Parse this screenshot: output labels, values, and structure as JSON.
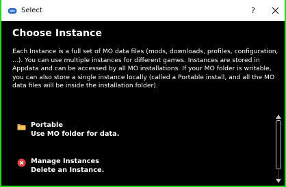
{
  "window": {
    "title": "Select",
    "help_label": "?",
    "app_icon": "controller-icon",
    "close_icon": "close-icon",
    "accent_color": "#19e019"
  },
  "page": {
    "heading": "Choose Instance",
    "description": "Each Instance is a full set of MO data files (mods, downloads, profiles, configuration, ...). You can use multiple instances for different games. Instances are stored in Appdata and can be accessed by all MO installations. If your MO folder is writable, you can also store a single instance locally (called a Portable install, and all the MO data files will be inside the installation folder)."
  },
  "options": [
    {
      "title": "Portable",
      "subtitle": "Use MO folder for data.",
      "icon": "folder-icon"
    },
    {
      "title": "Manage Instances",
      "subtitle": "Delete an Instance.",
      "icon": "delete-icon"
    }
  ]
}
